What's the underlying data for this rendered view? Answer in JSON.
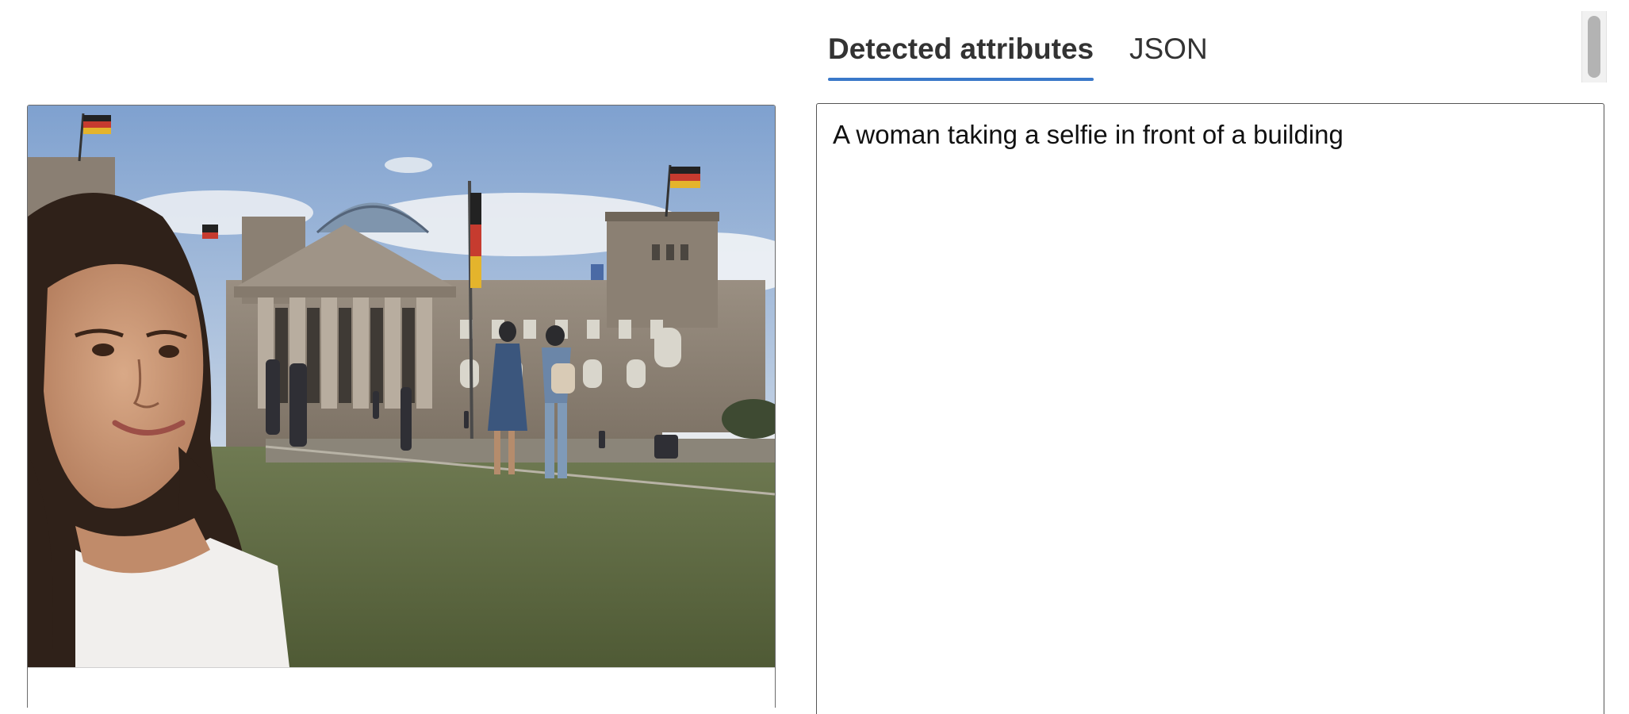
{
  "tabs": {
    "detected_attributes": "Detected attributes",
    "json": "JSON",
    "active": "detected_attributes"
  },
  "result": {
    "caption": "A woman taking a selfie in front of a building"
  },
  "colors": {
    "tab_underline": "#3a78c9",
    "panel_border": "#555555"
  }
}
